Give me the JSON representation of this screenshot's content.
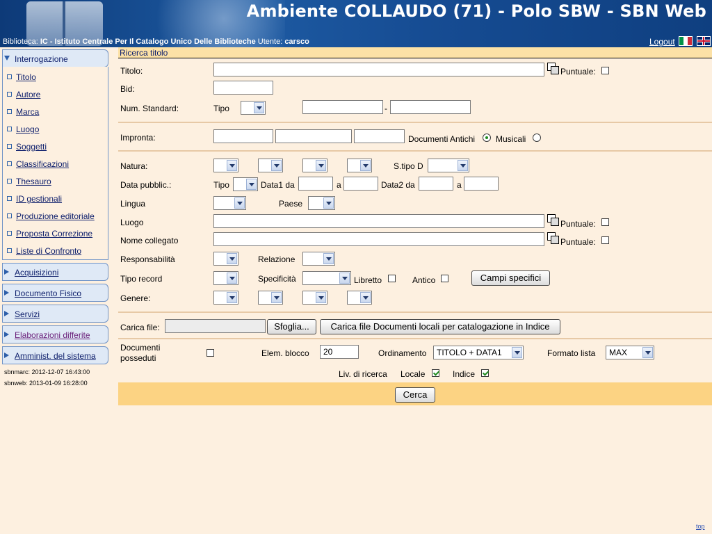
{
  "header": {
    "title": "Ambiente COLLAUDO (71) - Polo SBW - SBN Web",
    "biblioteca_label": "Biblioteca:",
    "biblioteca_value": "IC - Istituto Centrale Per Il Catalogo Unico Delle Biblioteche",
    "utente_label": "Utente:",
    "utente_value": "carsco",
    "logout": "Logout"
  },
  "sidebar": {
    "interrogazione": "Interrogazione",
    "items": [
      "Titolo",
      "Autore",
      "Marca",
      "Luogo",
      "Soggetti",
      "Classificazioni",
      "Thesauro",
      "ID gestionali",
      "Produzione editoriale",
      "Proposta Correzione",
      "Liste di Confronto"
    ],
    "sections": [
      "Acquisizioni",
      "Documento Fisico",
      "Servizi",
      "Elaborazioni differite",
      "Amminist. del sistema"
    ],
    "versions": [
      "sbnmarc:  2012-12-07 16:43:00",
      "sbnweb:   2013-01-09 16:28:00"
    ]
  },
  "form": {
    "breadcrumb": "Ricerca titolo",
    "titolo": "Titolo:",
    "puntuale": "Puntuale:",
    "bid": "Bid:",
    "num_standard": "Num. Standard:",
    "tipo": "Tipo",
    "dash": "-",
    "impronta": "Impronta:",
    "doc_antichi": "Documenti Antichi",
    "musicali": "Musicali",
    "natura": "Natura:",
    "stipo": "S.tipo D",
    "data_pubblic": "Data pubblic.:",
    "data1_da": "Data1 da",
    "a": "a",
    "data2_da": "Data2 da",
    "lingua": "Lingua",
    "paese": "Paese",
    "luogo": "Luogo",
    "nome_collegato": "Nome collegato",
    "responsabilita": "Responsabilità",
    "relazione": "Relazione",
    "tipo_record": "Tipo record",
    "specificita": "Specificità",
    "libretto": "Libretto",
    "antico": "Antico",
    "campi_specifici": "Campi specifici",
    "genere": "Genere:",
    "carica_file": "Carica file:",
    "sfoglia": "Sfoglia...",
    "carica_btn": "Carica file Documenti locali per catalogazione in Indice",
    "doc_posseduti_1": "Documenti",
    "doc_posseduti_2": "posseduti",
    "elem_blocco": "Elem. blocco",
    "elem_blocco_value": "20",
    "ordinamento": "Ordinamento",
    "ordinamento_value": "TITOLO + DATA1",
    "formato_lista": "Formato lista",
    "formato_lista_value": "MAX",
    "liv_ricerca": "Liv. di ricerca",
    "locale": "Locale",
    "indice": "Indice",
    "cerca": "Cerca"
  },
  "footer": {
    "top": "top"
  }
}
